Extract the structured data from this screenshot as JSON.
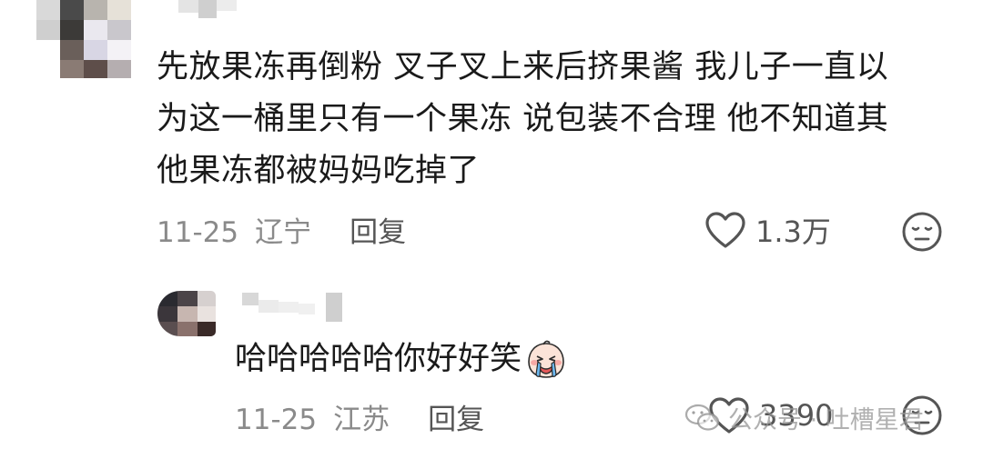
{
  "comment": {
    "lines": [
      "先放果冻再倒粉 叉子叉上来后挤果酱 我儿子一直以",
      "为这一桶里只有一个果冻 说包装不合理 他不知道其",
      "他果冻都被妈妈吃掉了"
    ],
    "date": "11-25",
    "location": "辽宁",
    "reply_label": "回复",
    "like_count": "1.3万"
  },
  "reply": {
    "text": "哈哈哈哈哈你好好笑",
    "date": "11-25",
    "location": "江苏",
    "reply_label": "回复",
    "like_count": "3390"
  },
  "watermark": {
    "text": "公众号 · 吐槽星君"
  },
  "icons": {
    "like": "heart-outline-icon",
    "emoji": "neutral-face-icon",
    "reply_emoji": "crying-face-emoji"
  },
  "colors": {
    "text": "#1a1a1a",
    "meta": "#8a8a8a",
    "icon": "#555555"
  }
}
